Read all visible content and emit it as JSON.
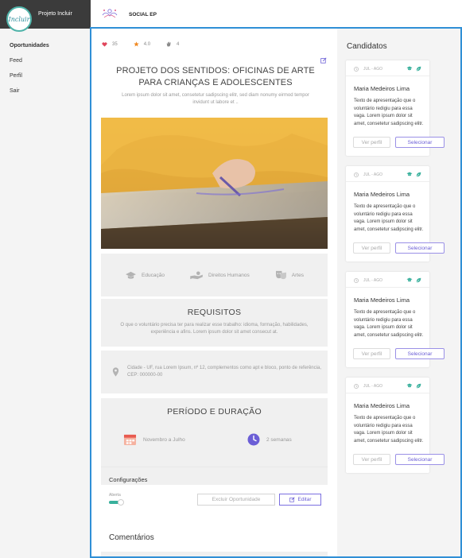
{
  "app": {
    "brand_title": "Projeto Incluir",
    "logo_text": "Incluir",
    "top_title": "SOCIAL EP"
  },
  "sidebar": {
    "items": [
      {
        "label": "Oportunidades",
        "active": true
      },
      {
        "label": "Feed",
        "active": false
      },
      {
        "label": "Perfil",
        "active": false
      },
      {
        "label": "Sair",
        "active": false
      }
    ]
  },
  "stats": {
    "likes": "35",
    "rating": "4.0",
    "applause": "4"
  },
  "opportunity": {
    "title": "PROJETO DOS SENTIDOS: OFICINAS DE ARTE PARA CRIANÇAS E ADOLESCENTES",
    "subtitle": "Lorem ipsum dolor sit amet, consetetur sadipscing elitr, sed diam nonumy eirmod tempor invidunt ut labore et .."
  },
  "categories": [
    {
      "label": "Educação",
      "icon": "graduation-cap-icon"
    },
    {
      "label": "Direitos Humanos",
      "icon": "helping-hand-icon"
    },
    {
      "label": "Artes",
      "icon": "theater-masks-icon"
    }
  ],
  "requirements": {
    "title": "REQUISITOS",
    "text": "O que o voluntário precisa ter para realizar esse trabalho: idioma, formação, habilidades, experiência e afins. Lorem ipsum dolor sit amet consecut at."
  },
  "address": {
    "text": "Cidade - UF, rua Lorem Ipsum, nº 12, complementos como apt e bloco, ponto de referência, CEP: 000000-00"
  },
  "period": {
    "title": "PERÍODO E DURAÇÃO",
    "months": "Novembro a Julho",
    "duration": "2 semanas"
  },
  "config": {
    "title": "Configurações",
    "toggle_label": "Aberta",
    "toggle_on": true,
    "delete_label": "Excluir Oportunidade",
    "edit_label": "Editar"
  },
  "comments": {
    "title": "Comentários"
  },
  "candidates": {
    "title": "Candidatos",
    "items": [
      {
        "date": "JUL - AGO",
        "name": "Maria Medeiros Lima",
        "text": "Texto de apresentação que o voluntário redigiu para essa vaga. Lorem ipsum dolor sit amet, consetetur sadipscing elitr.",
        "view_label": "Ver perfil",
        "select_label": "Selecionar"
      },
      {
        "date": "JUL - AGO",
        "name": "Maria Medeiros Lima",
        "text": "Texto de apresentação que o voluntário redigiu para essa vaga. Lorem ipsum dolor sit amet, consetetur sadipscing elitr.",
        "view_label": "Ver perfil",
        "select_label": "Selecionar"
      },
      {
        "date": "JUL - AGO",
        "name": "Maria Medeiros Lima",
        "text": "Texto de apresentação que o voluntário redigiu para essa vaga. Lorem ipsum dolor sit amet, consetetur sadipscing elitr.",
        "view_label": "Ver perfil",
        "select_label": "Selecionar"
      },
      {
        "date": "JUL - AGO",
        "name": "Maria Medeiros Lima",
        "text": "Texto de apresentação que o voluntário redigiu para essa vaga. Lorem ipsum dolor sit amet, consetetur sadipscing elitr.",
        "view_label": "Ver perfil",
        "select_label": "Selecionar"
      }
    ]
  },
  "colors": {
    "accent": "#2f8fd6",
    "primary": "#6b5ed6",
    "teal": "#39b09c",
    "heart": "#e0465c",
    "star": "#f08a24"
  }
}
